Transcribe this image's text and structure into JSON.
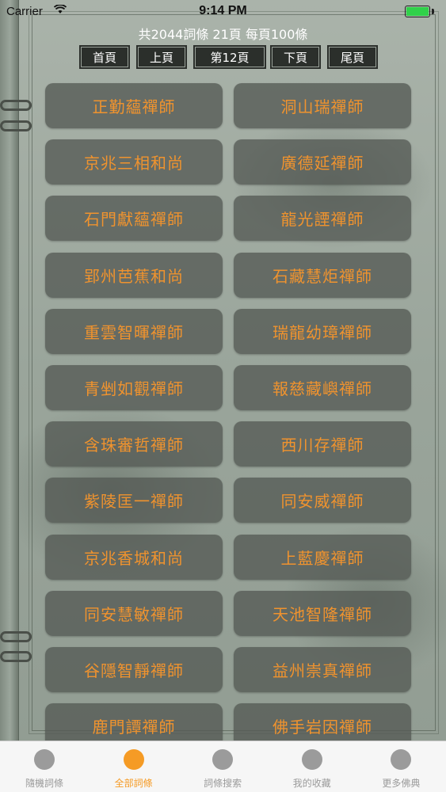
{
  "status_bar": {
    "carrier": "Carrier",
    "time": "9:14 PM",
    "battery_level": 1.0
  },
  "header": {
    "summary": "共2044詞條 21頁 每頁100條"
  },
  "pager": {
    "first": "首頁",
    "prev": "上頁",
    "current": "第12頁",
    "next": "下頁",
    "last": "尾頁"
  },
  "entries": [
    "正勤蘊禪師",
    "洞山瑞禪師",
    "京兆三相和尚",
    "廣德延禪師",
    "石門獻蘊禪師",
    "龍光諲禪師",
    "郢州芭蕉和尚",
    "石藏慧炬禪師",
    "重雲智暉禪師",
    "瑞龍幼璋禪師",
    "青剉如觀禪師",
    "報慈藏嶼禪師",
    "含珠審哲禪師",
    "西川存禪師",
    "紫陵匡一禪師",
    "同安威禪師",
    "京兆香城和尚",
    "上藍慶禪師",
    "同安慧敏禪師",
    "天池智隆禪師",
    "谷隱智靜禪師",
    "益州崇真禪師",
    "鹿門譚禪師",
    "佛手岩因禪師"
  ],
  "tabs": [
    {
      "label": "隨機詞條",
      "icon": "circle-icon",
      "active": false
    },
    {
      "label": "全部詞條",
      "icon": "circle-icon",
      "active": true
    },
    {
      "label": "詞條搜索",
      "icon": "circle-icon",
      "active": false
    },
    {
      "label": "我的收藏",
      "icon": "circle-icon",
      "active": false
    },
    {
      "label": "更多佛典",
      "icon": "circle-icon",
      "active": false
    }
  ],
  "colors": {
    "accent": "#f59b25",
    "entry_text": "#f0932e",
    "tab_inactive": "#9b9b9b"
  }
}
